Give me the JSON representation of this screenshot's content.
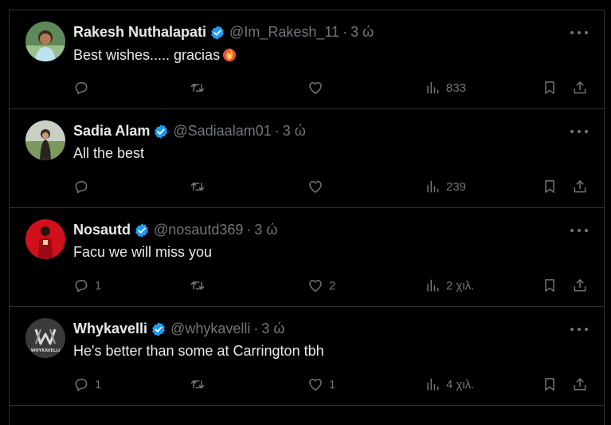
{
  "tweets": [
    {
      "name": "Rakesh Nuthalapati",
      "handle": "@Im_Rakesh_11",
      "sep": "·",
      "time": "3 ώ",
      "text": "Best wishes..... gracias",
      "emoji": "fire-icon",
      "replies": "",
      "retweets": "",
      "likes": "",
      "views": "833",
      "avatar_colors": [
        "#6a8f6a",
        "#cfe3f0"
      ]
    },
    {
      "name": "Sadia Alam",
      "handle": "@Sadiaalam01",
      "sep": "·",
      "time": "3 ώ",
      "text": "All the best",
      "replies": "",
      "retweets": "",
      "likes": "",
      "views": "239",
      "avatar_colors": [
        "#8aa27a",
        "#c9b8a0"
      ]
    },
    {
      "name": "Nosautd",
      "handle": "@nosautd369",
      "sep": "·",
      "time": "3 ώ",
      "text": "Facu we will miss you",
      "replies": "1",
      "retweets": "",
      "likes": "2",
      "views": "2 χιλ.",
      "avatar_colors": [
        "#d0101a",
        "#7a0a10"
      ]
    },
    {
      "name": "Whykavelli",
      "handle": "@whykavelli",
      "sep": "·",
      "time": "3 ώ",
      "text": "He's better than some at Carrington tbh",
      "replies": "1",
      "retweets": "",
      "likes": "1",
      "views": "4 χιλ.",
      "avatar_colors": [
        "#3a3a3a",
        "#d8d8d8"
      ],
      "avatar_text": "WHYKAVELLI"
    }
  ],
  "colors": {
    "background": "#000000",
    "text": "#e7e9ea",
    "muted": "#71767b",
    "verified": "#1d9bf0",
    "border": "#2f3336"
  }
}
